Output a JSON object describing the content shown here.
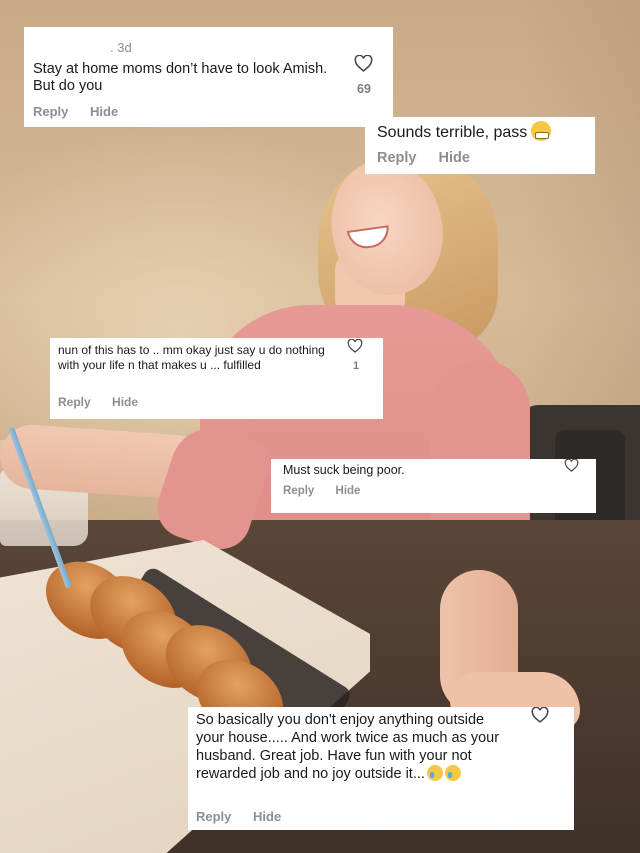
{
  "comments": [
    {
      "time": "3d",
      "text": "Stay at home moms don’t have to look Amish. But do you",
      "likes": "69",
      "actions": {
        "reply": "Reply",
        "hide": "Hide"
      }
    },
    {
      "text": "Sounds terrible, pass",
      "emoji": "grimacing-face-emoji",
      "actions": {
        "reply": "Reply",
        "hide": "Hide"
      }
    },
    {
      "text": "nun of this has to .. mm okay just say u do nothing with your life n that makes u ... fulfilled",
      "likes": "1",
      "actions": {
        "reply": "Reply",
        "hide": "Hide"
      }
    },
    {
      "text": "Must suck being poor.",
      "actions": {
        "reply": "Reply",
        "hide": "Hide"
      }
    },
    {
      "text": "So basically you don't enjoy anything outside your house..... And work twice as much as your husband. Great job. Have fun with your not rewarded job and no joy outside it...",
      "emoji": "crying-face-emoji",
      "actions": {
        "reply": "Reply",
        "hide": "Hide"
      }
    }
  ],
  "icons": {
    "like": "heart-outline-icon"
  },
  "colors": {
    "card_bg": "#ffffff",
    "muted_text": "#8e8e8e",
    "body_text": "#1a1a1a"
  }
}
